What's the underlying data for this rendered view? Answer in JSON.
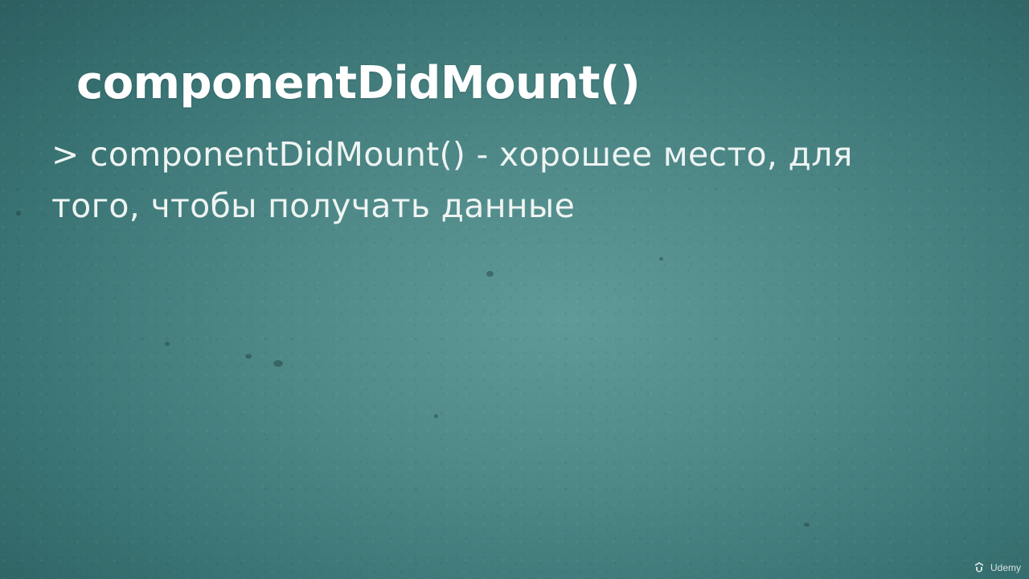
{
  "slide": {
    "title": "componentDidMount()",
    "bullet": "> componentDidMount() - хорошее место, для того, чтобы получать данные"
  },
  "watermark": {
    "logo_text": "Udemy",
    "icon": "udemy-logo-icon"
  },
  "colors": {
    "background_center": "#5f9a98",
    "background_edge": "#2d5f61",
    "text": "#ffffff"
  }
}
